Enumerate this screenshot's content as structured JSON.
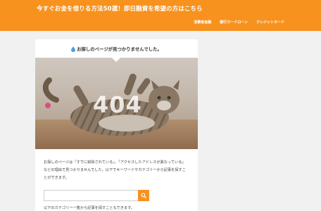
{
  "header": {
    "site_title": "今すぐお金を借りる方法50選！即日融資を希望の方はこちら",
    "nav": [
      {
        "label": "消費者金融"
      },
      {
        "label": "銀行カードローン"
      },
      {
        "label": "クレジットカード"
      }
    ]
  },
  "card": {
    "heading": "お探しのページが見つかりませんでした。",
    "hero_code": "404",
    "message": "お探しのページは「すでに削除されている」、「アクセスしたアドレスが異なっている」などの理由で見つかりませんでした。以下でキーワードやカテゴリーから記事を探すことができます。",
    "search": {
      "placeholder": "",
      "button_icon": "search-icon"
    },
    "category_text": "以下のカテゴリー一覧から記事を探すこともできます。"
  },
  "colors": {
    "accent": "#f7921e",
    "background": "#f1f1f1"
  }
}
